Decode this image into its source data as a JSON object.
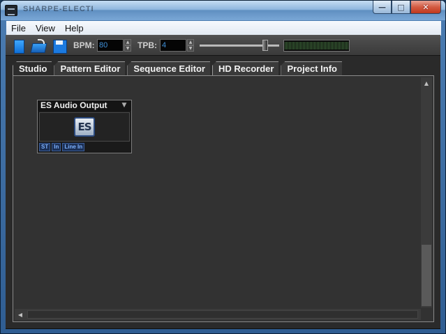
{
  "window": {
    "title": "SHARPE-ELECTRA-SOUND",
    "buttons": {
      "minimize": "—",
      "maximize": "□",
      "close": "✕"
    }
  },
  "menu": {
    "items": [
      "File",
      "View",
      "Help"
    ]
  },
  "toolbar": {
    "bpm_label": "BPM:",
    "bpm_value": "80",
    "tpb_label": "TPB:",
    "tpb_value": "4",
    "spin_up": "▲",
    "spin_down": "▼",
    "volume_level": 0.85,
    "meter_level": 1.0
  },
  "tabs": [
    "Studio",
    "Pattern Editor",
    "Sequence Editor",
    "HD Recorder",
    "Project Info"
  ],
  "active_tab": "Studio",
  "module": {
    "title": "ES Audio Output",
    "logo_text": "ES",
    "ports": [
      "ST",
      "In",
      "Line In"
    ]
  },
  "scroll": {
    "up": "▲",
    "left": "◀"
  },
  "colors": {
    "accent_blue": "#3e8fd8",
    "panel_dark": "#2a2a2a",
    "port_blue": "#7fb3ff"
  }
}
